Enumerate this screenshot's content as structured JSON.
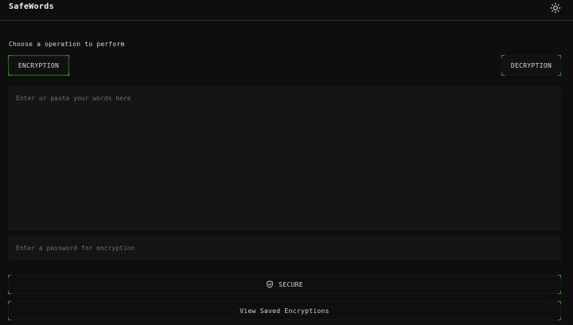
{
  "app": {
    "title": "SafeWords"
  },
  "header": {
    "theme_icon": "sun-icon"
  },
  "operation": {
    "prompt": "Choose a operation to perform",
    "encryption_label": "ENCRYPTION",
    "decryption_label": "DECRYPTION",
    "selected": "ENCRYPTION"
  },
  "inputs": {
    "words_placeholder": "Enter or paste your words here",
    "words_value": "",
    "password_placeholder": "Enter a password for encryption",
    "password_value": ""
  },
  "actions": {
    "secure_label": "SECURE",
    "secure_icon": "shield-check-icon",
    "saved_label": "View Saved Encryptions"
  },
  "colors": {
    "background": "#0e0e0e",
    "panel": "#151515",
    "accent_green": "#2e8b2e",
    "text": "#d9d9d9",
    "placeholder": "#6f6f6f"
  }
}
